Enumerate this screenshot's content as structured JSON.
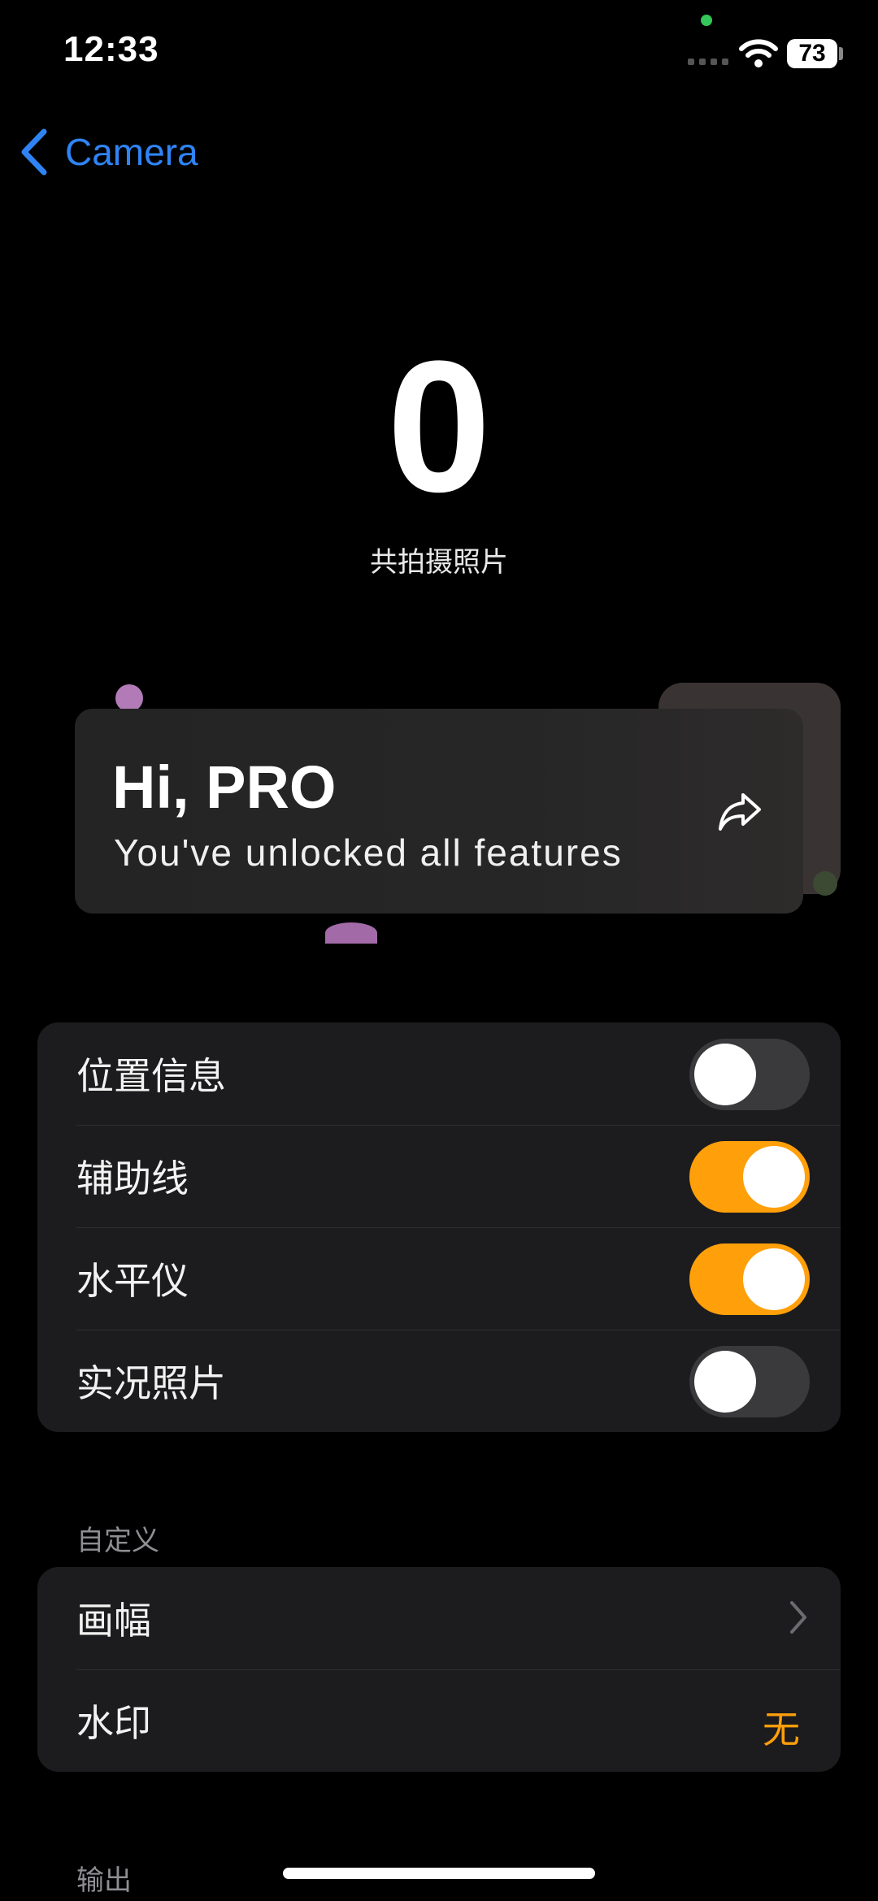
{
  "status_bar": {
    "time": "12:33",
    "battery": "73"
  },
  "nav": {
    "back_label": "Camera"
  },
  "stats": {
    "photo_count": "0",
    "photo_count_label": "共拍摄照片"
  },
  "pro_card": {
    "title": "Hi, PRO",
    "subtitle": "You've unlocked all features"
  },
  "toggles": [
    {
      "label": "位置信息",
      "on": false
    },
    {
      "label": "辅助线",
      "on": true
    },
    {
      "label": "水平仪",
      "on": true
    },
    {
      "label": "实况照片",
      "on": false
    }
  ],
  "custom_section": {
    "header": "自定义",
    "items": [
      {
        "label": "画幅"
      },
      {
        "label": "水印",
        "value": "无"
      }
    ]
  },
  "output_section": {
    "header": "输出"
  },
  "colors": {
    "accent_orange": "#ff9f0a",
    "link_blue": "#2f84f5",
    "background": "#000000",
    "cell_background": "#1c1c1e"
  }
}
